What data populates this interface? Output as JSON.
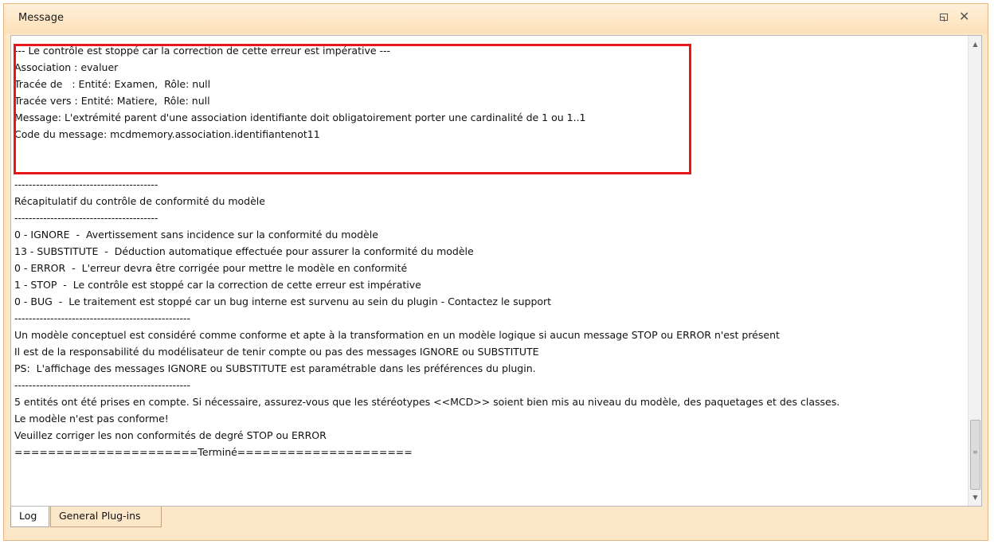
{
  "window": {
    "title": "Message",
    "restore_icon": "restore-window-icon",
    "close_icon": "close-icon"
  },
  "messages": [
    "--- Le contrôle est stoppé car la correction de cette erreur est impérative ---",
    "Association : evaluer",
    "Tracée de   : Entité: Examen,  Rôle: null",
    "Tracée vers : Entité: Matiere,  Rôle: null",
    "Message: L'extrémité parent d'une association identifiante doit obligatoirement porter une cardinalité de 1 ou 1..1",
    "Code du message: mcdmemory.association.identifiantenot11",
    "",
    "",
    "----------------------------------------",
    "Récapitulatif du contrôle de conformité du modèle",
    "----------------------------------------",
    "0 - IGNORE  -  Avertissement sans incidence sur la conformité du modèle",
    "13 - SUBSTITUTE  -  Déduction automatique effectuée pour assurer la conformité du modèle",
    "0 - ERROR  -  L'erreur devra être corrigée pour mettre le modèle en conformité",
    "1 - STOP  -  Le contrôle est stoppé car la correction de cette erreur est impérative",
    "0 - BUG  -  Le traitement est stoppé car un bug interne est survenu au sein du plugin - Contactez le support",
    "-------------------------------------------------",
    "Un modèle conceptuel est considéré comme conforme et apte à la transformation en un modèle logique si aucun message STOP ou ERROR n'est présent",
    "Il est de la responsabilité du modélisateur de tenir compte ou pas des messages IGNORE ou SUBSTITUTE",
    "PS:  L'affichage des messages IGNORE ou SUBSTITUTE est paramétrable dans les préférences du plugin.",
    "-------------------------------------------------",
    "5 entités ont été prises en compte. Si nécessaire, assurez-vous que les stéréotypes <<MCD>> soient bien mis au niveau du modèle, des paquetages et des classes.",
    "Le modèle n'est pas conforme!",
    "Veuillez corriger les non conformités de degré STOP ou ERROR",
    "======================Terminé====================="
  ],
  "scrollbar": {
    "up_icon": "scroll-up-arrow-icon",
    "down_icon": "scroll-down-arrow-icon"
  },
  "tabs": [
    {
      "label": "Log",
      "active": true
    },
    {
      "label": "General Plug-ins",
      "active": false
    }
  ],
  "colors": {
    "highlight_border": "#e81818",
    "titlebar": "#fde0b8",
    "frame": "#e9b47e"
  }
}
